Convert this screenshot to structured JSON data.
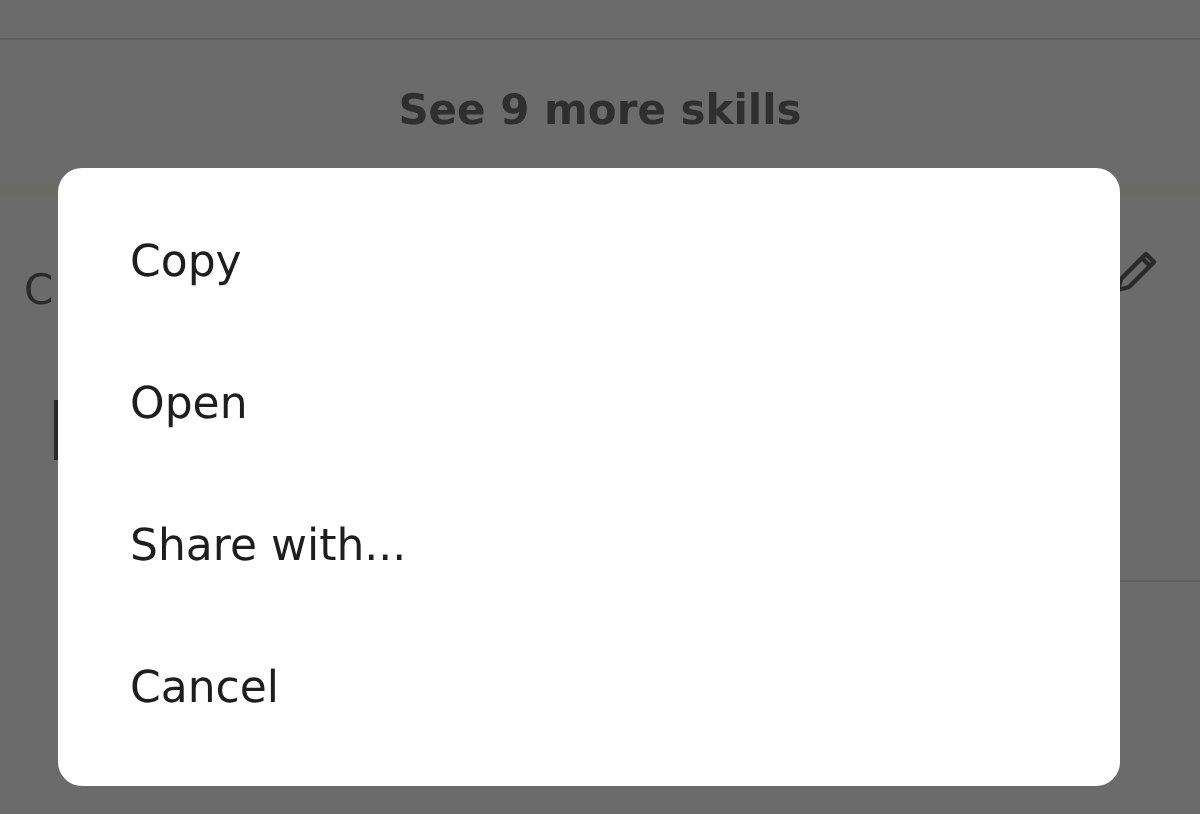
{
  "page": {
    "more_skills_link": "See 9 more skills",
    "section_title": "C"
  },
  "dialog": {
    "options": [
      {
        "label": "Copy"
      },
      {
        "label": "Open"
      },
      {
        "label": "Share with..."
      },
      {
        "label": "Cancel"
      }
    ]
  }
}
